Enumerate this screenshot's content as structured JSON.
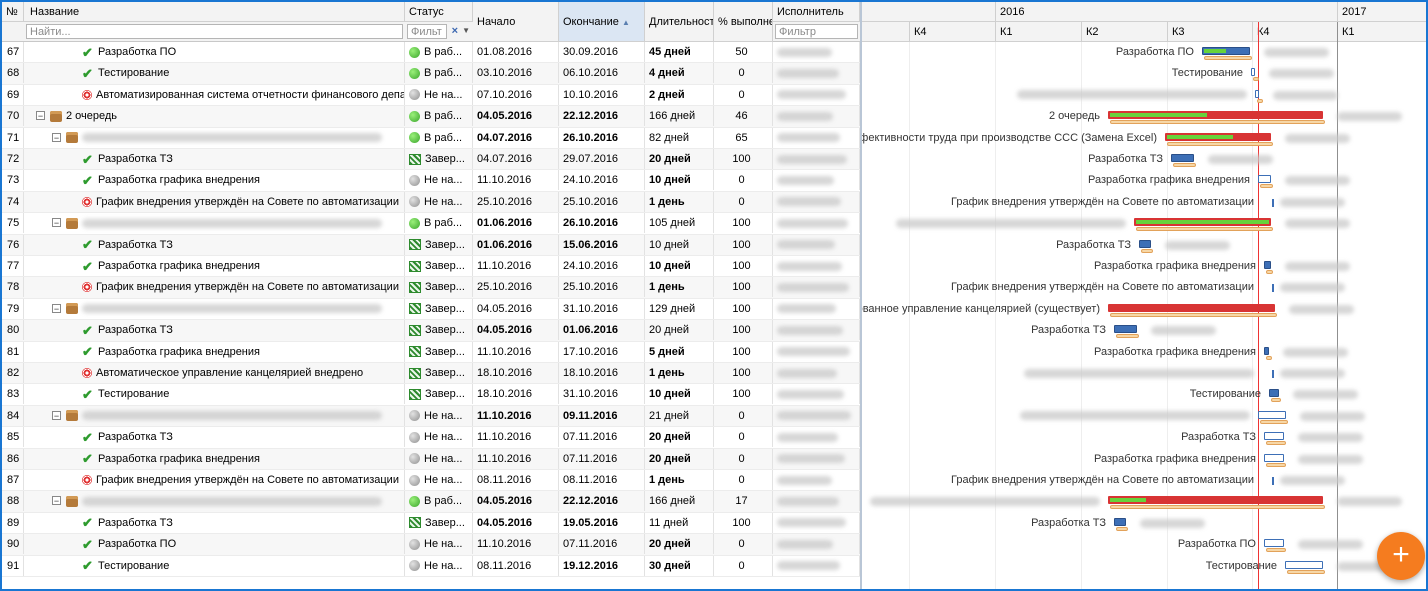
{
  "columns": {
    "num": "№",
    "name": "Название",
    "status": "Статус",
    "start": "Начало",
    "end": "Окончание",
    "duration": "Длительность",
    "percent": "% выполнен",
    "assignee": "Исполнитель"
  },
  "filters": {
    "name_placeholder": "Найти...",
    "status_placeholder": "Фильт",
    "assignee_placeholder": "Фильтр"
  },
  "timeline": {
    "years": [
      "2016",
      "2017"
    ],
    "quarters": [
      "К4",
      "К1",
      "К2",
      "К3",
      "К4",
      "К1"
    ]
  },
  "rows": [
    {
      "num": "67",
      "level": 2,
      "icon": "check",
      "name": "Разработка ПО",
      "status_icon": "green",
      "status": "В раб...",
      "start": "01.08.2016",
      "start_bold": false,
      "end": "30.09.2016",
      "end_bold": false,
      "duration": "45 дней",
      "dur_bold": true,
      "percent": "50",
      "gantt_label": "Разработка ПО",
      "bar": {
        "type": "task",
        "start": 0.602,
        "end": 0.688,
        "progress": 0.5
      }
    },
    {
      "num": "68",
      "level": 2,
      "icon": "check",
      "name": "Тестирование",
      "status_icon": "green",
      "status": "В раб...",
      "start": "03.10.2016",
      "start_bold": false,
      "end": "06.10.2016",
      "end_bold": false,
      "duration": "4 дней",
      "dur_bold": true,
      "percent": "0",
      "gantt_label": "Тестирование",
      "bar": {
        "type": "open",
        "start": 0.69,
        "end": 0.697,
        "progress": 0
      }
    },
    {
      "num": "69",
      "level": 2,
      "icon": "target",
      "name": "Автоматизированная система отчетности финансового департамент",
      "status_icon": "grey",
      "status": "Не на...",
      "start": "07.10.2016",
      "start_bold": false,
      "end": "10.10.2016",
      "end_bold": false,
      "duration": "2 дней",
      "dur_bold": true,
      "percent": "0",
      "gantt_label": "",
      "bar": {
        "type": "open",
        "start": 0.697,
        "end": 0.703,
        "progress": 0
      }
    },
    {
      "num": "70",
      "level": 0,
      "icon": "folder",
      "toggle": true,
      "name": "2 очередь",
      "status_icon": "green",
      "status": "В раб...",
      "start": "04.05.2016",
      "start_bold": true,
      "end": "22.12.2016",
      "end_bold": true,
      "duration": "166 дней",
      "dur_bold": false,
      "percent": "46",
      "gantt_label": "2 очередь",
      "bar": {
        "type": "summary",
        "start": 0.436,
        "end": 0.818,
        "progress": 0.46
      }
    },
    {
      "num": "71",
      "level": 1,
      "icon": "folder",
      "toggle": true,
      "name": "",
      "status_icon": "green",
      "status": "В раб...",
      "start": "04.07.2016",
      "start_bold": true,
      "end": "26.10.2016",
      "end_bold": true,
      "duration": "82 дней",
      "dur_bold": false,
      "percent": "65",
      "gantt_label": "ти и эффективности труда при производстве ССС (Замена Excel)",
      "bar": {
        "type": "summary",
        "start": 0.538,
        "end": 0.726,
        "progress": 0.65
      }
    },
    {
      "num": "72",
      "level": 2,
      "icon": "check",
      "name": "Разработка ТЗ",
      "status_icon": "flag",
      "status": "Завер...",
      "start": "04.07.2016",
      "start_bold": false,
      "end": "29.07.2016",
      "end_bold": false,
      "duration": "20 дней",
      "dur_bold": true,
      "percent": "100",
      "gantt_label": "Разработка ТЗ",
      "bar": {
        "type": "task",
        "start": 0.547,
        "end": 0.588,
        "progress": 0
      }
    },
    {
      "num": "73",
      "level": 2,
      "icon": "check",
      "name": "Разработка графика внедрения",
      "status_icon": "grey",
      "status": "Не на...",
      "start": "11.10.2016",
      "start_bold": false,
      "end": "24.10.2016",
      "end_bold": false,
      "duration": "10 дней",
      "dur_bold": true,
      "percent": "0",
      "gantt_label": "Разработка графика внедрения",
      "bar": {
        "type": "open",
        "start": 0.703,
        "end": 0.726,
        "progress": 0
      }
    },
    {
      "num": "74",
      "level": 2,
      "icon": "target",
      "name": "График внедрения утверждён на Совете по автоматизации",
      "status_icon": "grey",
      "status": "Не на...",
      "start": "25.10.2016",
      "start_bold": false,
      "end": "25.10.2016",
      "end_bold": false,
      "duration": "1 день",
      "dur_bold": true,
      "percent": "0",
      "gantt_label": "График внедрения утверждён на Совете по автоматизации",
      "bar": null
    },
    {
      "num": "75",
      "level": 1,
      "icon": "folder",
      "toggle": true,
      "name": "",
      "status_icon": "green",
      "status": "В раб...",
      "start": "01.06.2016",
      "start_bold": true,
      "end": "26.10.2016",
      "end_bold": true,
      "duration": "105 дней",
      "dur_bold": false,
      "percent": "100",
      "gantt_label": "",
      "bar": {
        "type": "summary",
        "start": 0.482,
        "end": 0.726,
        "progress": 1
      }
    },
    {
      "num": "76",
      "level": 2,
      "icon": "check",
      "name": "Разработка ТЗ",
      "status_icon": "flag",
      "status": "Завер...",
      "start": "01.06.2016",
      "start_bold": true,
      "end": "15.06.2016",
      "end_bold": true,
      "duration": "10 дней",
      "dur_bold": false,
      "percent": "100",
      "gantt_label": "Разработка ТЗ",
      "bar": {
        "type": "task",
        "start": 0.492,
        "end": 0.513,
        "progress": 0
      }
    },
    {
      "num": "77",
      "level": 2,
      "icon": "check",
      "name": "Разработка графика внедрения",
      "status_icon": "flag",
      "status": "Завер...",
      "start": "11.10.2016",
      "start_bold": false,
      "end": "24.10.2016",
      "end_bold": false,
      "duration": "10 дней",
      "dur_bold": true,
      "percent": "100",
      "gantt_label": "Разработка графика внедрения",
      "bar": {
        "type": "task",
        "start": 0.712,
        "end": 0.726,
        "progress": 0
      }
    },
    {
      "num": "78",
      "level": 2,
      "icon": "target",
      "name": "График внедрения утверждён на Совете по автоматизации",
      "status_icon": "flag",
      "status": "Завер...",
      "start": "25.10.2016",
      "start_bold": false,
      "end": "25.10.2016",
      "end_bold": false,
      "duration": "1 день",
      "dur_bold": true,
      "percent": "100",
      "gantt_label": "График внедрения утверждён на Совете по автоматизации",
      "bar": null
    },
    {
      "num": "79",
      "level": 1,
      "icon": "folder",
      "toggle": true,
      "name": "",
      "status_icon": "flag",
      "status": "Завер...",
      "start": "04.05.2016",
      "start_bold": false,
      "end": "31.10.2016",
      "end_bold": false,
      "duration": "129 дней",
      "dur_bold": false,
      "percent": "100",
      "gantt_label": "изированное управление канцелярией (существует)",
      "bar": {
        "type": "summary",
        "start": 0.436,
        "end": 0.733,
        "progress": 0
      }
    },
    {
      "num": "80",
      "level": 2,
      "icon": "check",
      "name": "Разработка ТЗ",
      "status_icon": "flag",
      "status": "Завер...",
      "start": "04.05.2016",
      "start_bold": true,
      "end": "01.06.2016",
      "end_bold": true,
      "duration": "20 дней",
      "dur_bold": false,
      "percent": "100",
      "gantt_label": "Разработка ТЗ",
      "bar": {
        "type": "task",
        "start": 0.446,
        "end": 0.488,
        "progress": 0
      }
    },
    {
      "num": "81",
      "level": 2,
      "icon": "check",
      "name": "Разработка графика внедрения",
      "status_icon": "flag",
      "status": "Завер...",
      "start": "11.10.2016",
      "start_bold": false,
      "end": "17.10.2016",
      "end_bold": false,
      "duration": "5 дней",
      "dur_bold": true,
      "percent": "100",
      "gantt_label": "Разработка графика внедрения",
      "bar": {
        "type": "task",
        "start": 0.712,
        "end": 0.722,
        "progress": 0
      }
    },
    {
      "num": "82",
      "level": 2,
      "icon": "target",
      "name": "Автоматическое управление канцелярией внедрено",
      "status_icon": "flag",
      "status": "Завер...",
      "start": "18.10.2016",
      "start_bold": false,
      "end": "18.10.2016",
      "end_bold": false,
      "duration": "1 день",
      "dur_bold": true,
      "percent": "100",
      "gantt_label": "",
      "bar": null
    },
    {
      "num": "83",
      "level": 2,
      "icon": "check",
      "name": "Тестирование",
      "status_icon": "flag",
      "status": "Завер...",
      "start": "18.10.2016",
      "start_bold": false,
      "end": "31.10.2016",
      "end_bold": false,
      "duration": "10 дней",
      "dur_bold": true,
      "percent": "100",
      "gantt_label": "Тестирование",
      "bar": {
        "type": "task",
        "start": 0.722,
        "end": 0.74,
        "progress": 0
      }
    },
    {
      "num": "84",
      "level": 1,
      "icon": "folder",
      "toggle": true,
      "name": "",
      "status_icon": "grey",
      "status": "Не на...",
      "start": "11.10.2016",
      "start_bold": true,
      "end": "09.11.2016",
      "end_bold": true,
      "duration": "21 дней",
      "dur_bold": false,
      "percent": "0",
      "gantt_label": "",
      "bar": {
        "type": "open",
        "start": 0.703,
        "end": 0.752,
        "progress": 0
      }
    },
    {
      "num": "85",
      "level": 2,
      "icon": "check",
      "name": "Разработка ТЗ",
      "status_icon": "grey",
      "status": "Не на...",
      "start": "11.10.2016",
      "start_bold": false,
      "end": "07.11.2016",
      "end_bold": false,
      "duration": "20 дней",
      "dur_bold": true,
      "percent": "0",
      "gantt_label": "Разработка ТЗ",
      "bar": {
        "type": "open",
        "start": 0.712,
        "end": 0.748,
        "progress": 0
      }
    },
    {
      "num": "86",
      "level": 2,
      "icon": "check",
      "name": "Разработка графика внедрения",
      "status_icon": "grey",
      "status": "Не на...",
      "start": "11.10.2016",
      "start_bold": false,
      "end": "07.11.2016",
      "end_bold": false,
      "duration": "20 дней",
      "dur_bold": true,
      "percent": "0",
      "gantt_label": "Разработка графика внедрения",
      "bar": {
        "type": "open",
        "start": 0.712,
        "end": 0.748,
        "progress": 0
      }
    },
    {
      "num": "87",
      "level": 2,
      "icon": "target",
      "name": "График внедрения утверждён на Совете по автоматизации",
      "status_icon": "grey",
      "status": "Не на...",
      "start": "08.11.2016",
      "start_bold": false,
      "end": "08.11.2016",
      "end_bold": false,
      "duration": "1 день",
      "dur_bold": true,
      "percent": "0",
      "gantt_label": "График внедрения утверждён на Совете по автоматизации",
      "bar": null
    },
    {
      "num": "88",
      "level": 1,
      "icon": "folder",
      "toggle": true,
      "name": "",
      "status_icon": "green",
      "status": "В раб...",
      "start": "04.05.2016",
      "start_bold": true,
      "end": "22.12.2016",
      "end_bold": true,
      "duration": "166 дней",
      "dur_bold": false,
      "percent": "17",
      "gantt_label": "",
      "bar": {
        "type": "summary",
        "start": 0.436,
        "end": 0.818,
        "progress": 0.17
      }
    },
    {
      "num": "89",
      "level": 2,
      "icon": "check",
      "name": "Разработка ТЗ",
      "status_icon": "flag",
      "status": "Завер...",
      "start": "04.05.2016",
      "start_bold": true,
      "end": "19.05.2016",
      "end_bold": true,
      "duration": "11 дней",
      "dur_bold": false,
      "percent": "100",
      "gantt_label": "Разработка ТЗ",
      "bar": {
        "type": "task",
        "start": 0.446,
        "end": 0.468,
        "progress": 0
      }
    },
    {
      "num": "90",
      "level": 2,
      "icon": "check",
      "name": "Разработка ПО",
      "status_icon": "grey",
      "status": "Не на...",
      "start": "11.10.2016",
      "start_bold": false,
      "end": "07.11.2016",
      "end_bold": false,
      "duration": "20 дней",
      "dur_bold": true,
      "percent": "0",
      "gantt_label": "Разработка ПО",
      "bar": {
        "type": "open",
        "start": 0.712,
        "end": 0.748,
        "progress": 0
      }
    },
    {
      "num": "91",
      "level": 2,
      "icon": "check",
      "name": "Тестирование",
      "status_icon": "grey",
      "status": "Не на...",
      "start": "08.11.2016",
      "start_bold": false,
      "end": "19.12.2016",
      "end_bold": true,
      "duration": "30 дней",
      "dur_bold": true,
      "percent": "0",
      "gantt_label": "Тестирование",
      "bar": {
        "type": "open",
        "start": 0.75,
        "end": 0.818,
        "progress": 0
      }
    }
  ],
  "fab": {
    "label": "+"
  }
}
